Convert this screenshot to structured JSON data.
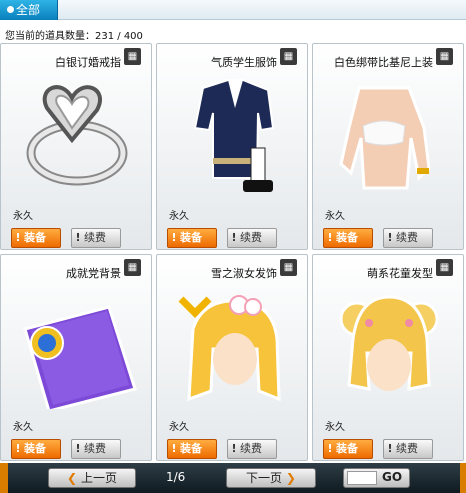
{
  "tab": {
    "label": "全部"
  },
  "count_text": "您当前的道具数量：231 / 400",
  "items": [
    {
      "name": "白银订婚戒指",
      "duration": "永久",
      "equip": "装备",
      "renew": "续费"
    },
    {
      "name": "气质学生服饰",
      "duration": "永久",
      "equip": "装备",
      "renew": "续费"
    },
    {
      "name": "白色绑带比基尼上装",
      "duration": "永久",
      "equip": "装备",
      "renew": "续费"
    },
    {
      "name": "成就党背景",
      "duration": "永久",
      "equip": "装备",
      "renew": "续费"
    },
    {
      "name": "雪之淑女发饰",
      "duration": "永久",
      "equip": "装备",
      "renew": "续费"
    },
    {
      "name": "萌系花童发型",
      "duration": "永久",
      "equip": "装备",
      "renew": "续费"
    }
  ],
  "pager": {
    "prev": "上一页",
    "next": "下一页",
    "page": "1/6",
    "go": "GO"
  },
  "colors": {
    "accent": "#0a7fbd",
    "equip": "#f07800",
    "footer": "#1a262d"
  }
}
